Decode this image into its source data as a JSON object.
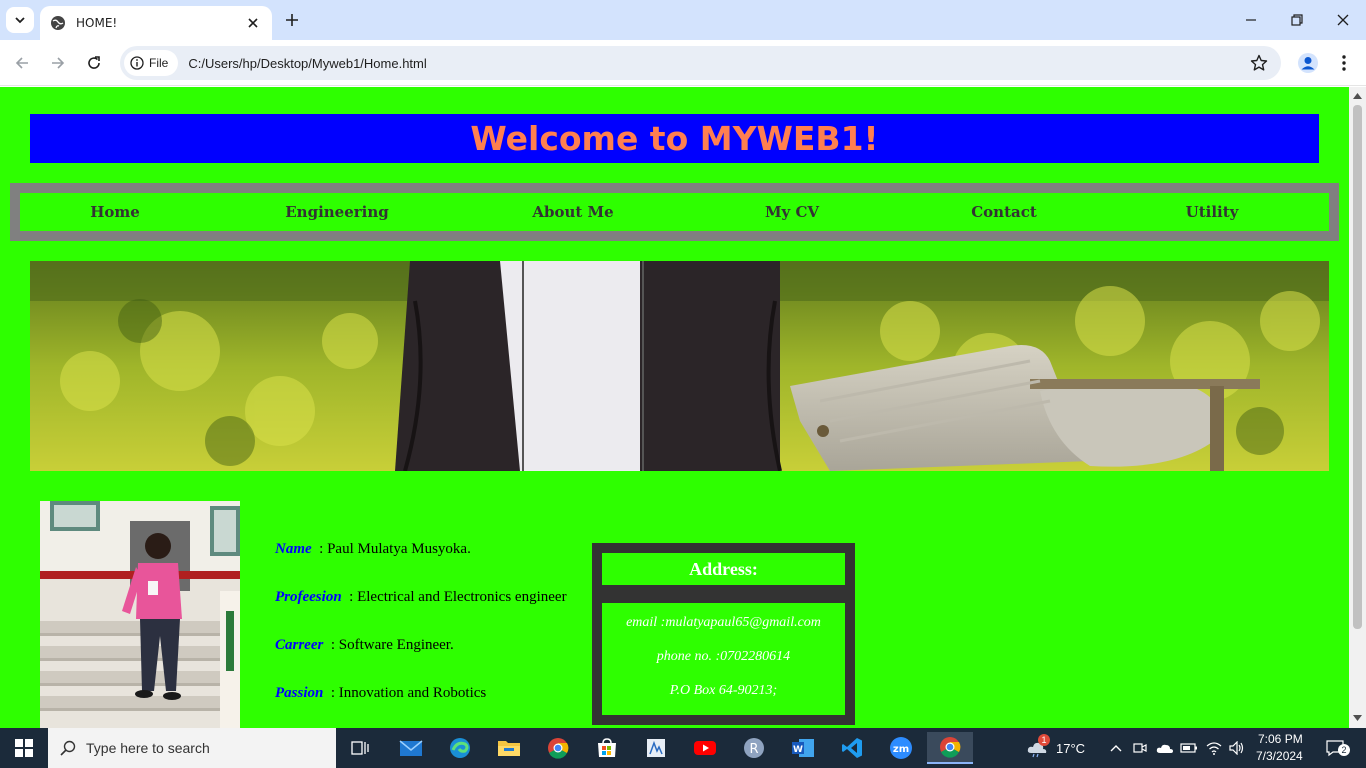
{
  "browser": {
    "tab_title": "HOME!",
    "site_chip_label": "File",
    "url": "C:/Users/hp/Desktop/Myweb1/Home.html"
  },
  "page": {
    "banner_title": "Welcome to MYWEB1!",
    "nav": [
      "Home",
      "Engineering",
      "About Me",
      "My CV",
      "Contact",
      "Utility"
    ],
    "profile": [
      {
        "label": "Name",
        "value": ": Paul Mulatya Musyoka."
      },
      {
        "label": "Profeesion",
        "value": ": Electrical and Electronics engineer"
      },
      {
        "label": "Carreer",
        "value": ": Software Engineer."
      },
      {
        "label": "Passion",
        "value": ": Innovation and Robotics"
      }
    ],
    "address": {
      "heading": "Address:",
      "email": "email :mulatyapaul65@gmail.com",
      "phone": "phone no. :0702280614",
      "po_box": "P.O Box 64-90213;"
    }
  },
  "taskbar": {
    "search_placeholder": "Type here to search",
    "weather_temp": "17°C",
    "weather_badge": "1",
    "time": "7:06 PM",
    "date": "7/3/2024",
    "notification_count": "2",
    "apps": [
      "task-view",
      "mail",
      "edge",
      "file-explorer",
      "chrome",
      "microsoft-store",
      "app",
      "youtube",
      "r",
      "word",
      "vscode",
      "zoom",
      "chrome-active"
    ]
  },
  "colors": {
    "page_bg": "#2eff00",
    "banner_bg": "#0000ff",
    "banner_text": "#ff7f50",
    "nav_border": "#808080",
    "label_blue": "#0000ff",
    "address_frame": "#333333"
  }
}
